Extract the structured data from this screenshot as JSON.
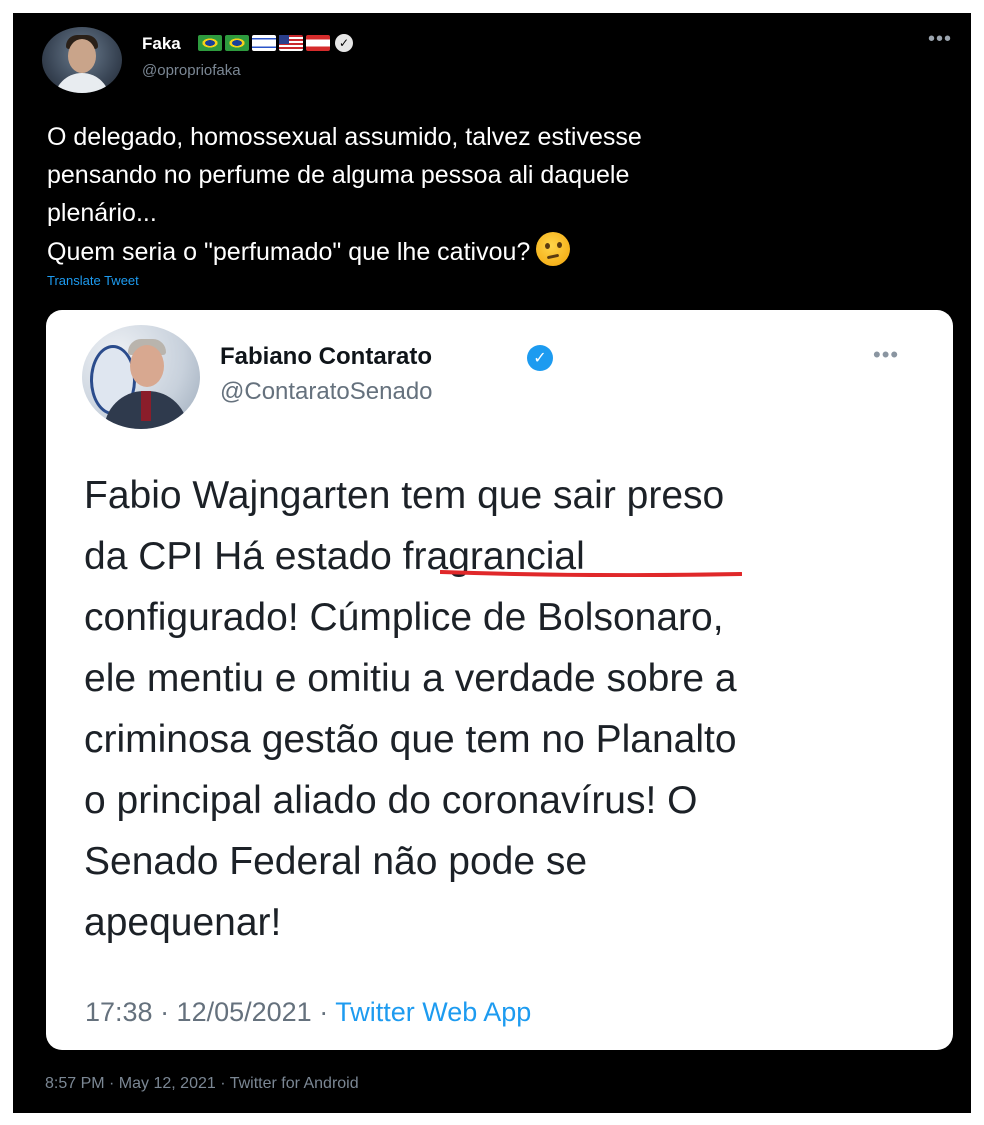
{
  "main_tweet": {
    "author_name": "Faka",
    "flags": [
      "brazil-flag-icon",
      "brazil-flag-icon",
      "israel-flag-icon",
      "usa-flag-icon",
      "lebanon-flag-icon"
    ],
    "handle": "@opropriofaka",
    "text_lines": [
      "O delegado, homossexual assumido, talvez estivesse",
      "pensando no perfume de alguma pessoa ali daquele",
      "plenário...",
      "Quem seria o \"perfumado\" que lhe cativou?"
    ],
    "emoji": "thinking-face-icon",
    "translate_label": "Translate Tweet",
    "timestamp": "8:57 PM · May 12, 2021 · Twitter for Android"
  },
  "quoted_tweet": {
    "author_name": "Fabiano Contarato",
    "handle": "@ContaratoSenado",
    "text_lines": [
      "Fabio Wajngarten tem que sair preso",
      "da CPI Há estado fragrancial",
      "configurado! Cúmplice de Bolsonaro,",
      "ele mentiu e omitiu a verdade sobre a",
      "criminosa gestão que tem no Planalto",
      "o principal aliado do coronavírus! O",
      "Senado Federal não pode se",
      "apequenar!"
    ],
    "time": "17:38 · 12/05/2021 · ",
    "app": "Twitter Web App"
  },
  "colors": {
    "background": "#000000",
    "card": "#ffffff",
    "link_blue": "#1d9bf0",
    "verified_blue": "#1d9bf0",
    "highlight_red": "#e0282a"
  }
}
